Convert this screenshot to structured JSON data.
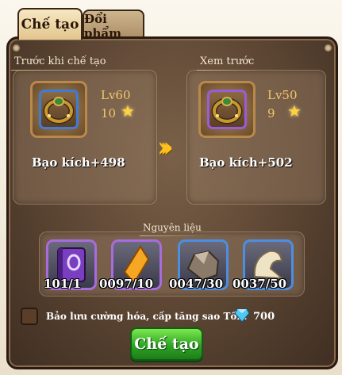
{
  "tabs": [
    {
      "label": "Chế tạo",
      "active": true
    },
    {
      "label": "Đổi phẩm",
      "active": false
    }
  ],
  "before": {
    "header": "Trước khi chế tạo",
    "level": "Lv60",
    "stars": "10",
    "stat_name": "Bạo kích",
    "stat_value": "+498",
    "item_icon": "ring-icon"
  },
  "preview": {
    "header": "Xem trước",
    "level": "Lv50",
    "stars": "9",
    "stat_name": "Bạo kích",
    "stat_value": "+502",
    "item_icon": "ring-icon"
  },
  "materials": {
    "header": "Nguyên liệu",
    "items": [
      {
        "icon": "purple-book-icon",
        "count": "101/1",
        "rarity": "purple"
      },
      {
        "icon": "amber-crystal-icon",
        "count": "0097/10",
        "rarity": "purple"
      },
      {
        "icon": "ore-rock-icon",
        "count": "0047/30",
        "rarity": "blue"
      },
      {
        "icon": "cream-cloth-icon",
        "count": "0037/50",
        "rarity": "blue"
      }
    ]
  },
  "keep_option": {
    "label": "Bảo lưu cường hóa, cấp tăng sao Tốn:",
    "checked": false
  },
  "cost": {
    "value": "700",
    "currency_icon": "diamond-icon"
  },
  "craft_button": "Chế tạo",
  "colors": {
    "accent_green": "#2fa524",
    "gold": "#ffc21c",
    "purple_rarity": "#a86be0",
    "blue_rarity": "#4e8ee0"
  }
}
